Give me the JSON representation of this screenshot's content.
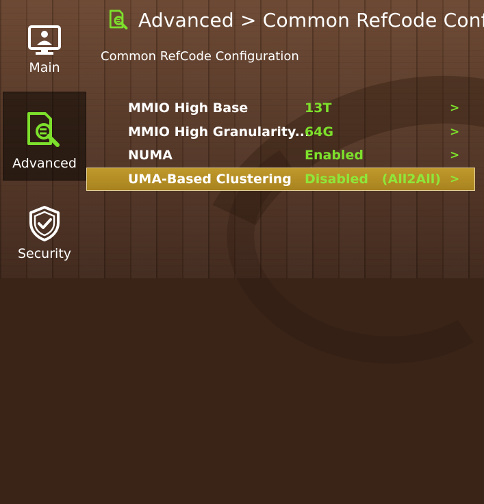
{
  "sidebar": {
    "items": [
      {
        "label": "Main",
        "icon": "monitor-user-icon"
      },
      {
        "label": "Advanced",
        "icon": "document-search-icon",
        "selected": true
      },
      {
        "label": "Security",
        "icon": "shield-check-icon"
      }
    ]
  },
  "header": {
    "icon": "document-search-icon",
    "title": "Advanced > Common RefCode Confi"
  },
  "subtitle": "Common RefCode Configuration",
  "options": [
    {
      "name": "MMIO High Base",
      "value": "13T",
      "arrow": ">"
    },
    {
      "name": "MMIO High Granularity...",
      "value": "64G",
      "arrow": ">"
    },
    {
      "name": "NUMA",
      "value": "Enabled",
      "arrow": ">"
    },
    {
      "name": "UMA-Based Clustering",
      "value": "Disabled   (All2All)",
      "arrow": ">",
      "selected": true
    }
  ],
  "colors": {
    "accent_green": "#7de02c",
    "selection": "#b08a24",
    "text": "#ffffff"
  }
}
